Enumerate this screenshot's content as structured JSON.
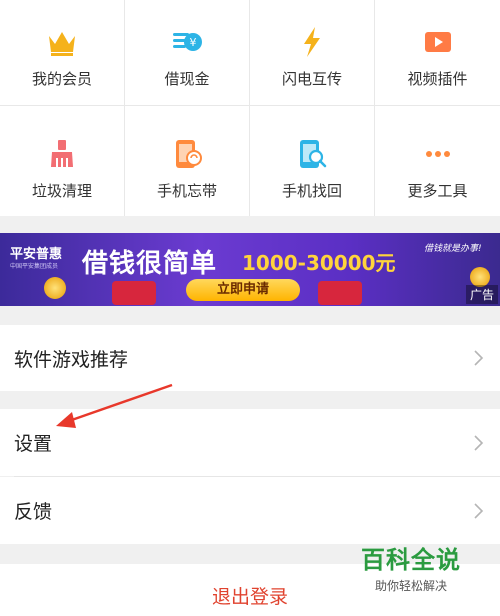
{
  "tools": [
    {
      "label": "我的会员",
      "icon": "crown-icon"
    },
    {
      "label": "借现金",
      "icon": "cash-icon"
    },
    {
      "label": "闪电互传",
      "icon": "lightning-icon"
    },
    {
      "label": "视频插件",
      "icon": "video-play-icon"
    },
    {
      "label": "垃圾清理",
      "icon": "broom-icon"
    },
    {
      "label": "手机忘带",
      "icon": "phone-sync-icon"
    },
    {
      "label": "手机找回",
      "icon": "phone-search-icon"
    },
    {
      "label": "更多工具",
      "icon": "more-dots-icon"
    }
  ],
  "banner": {
    "brand": "平安普惠",
    "brand_sub": "中国平安集团成员",
    "headline": "借钱很简单",
    "amount": "1000-30000元",
    "slogan": "借钱就是办事!",
    "apply_label": "立即申请",
    "ad_tag": "广告"
  },
  "menu": {
    "recommend": "软件游戏推荐",
    "settings": "设置",
    "feedback": "反馈"
  },
  "logout": "退出登录",
  "watermark": {
    "main": "百科全说",
    "sub": "助你轻松解决"
  },
  "colors": {
    "accent_orange": "#ff8a3d",
    "logout_red": "#e0432f",
    "banner_purple": "#5b2fc4",
    "annotation_arrow": "#e8382b"
  }
}
